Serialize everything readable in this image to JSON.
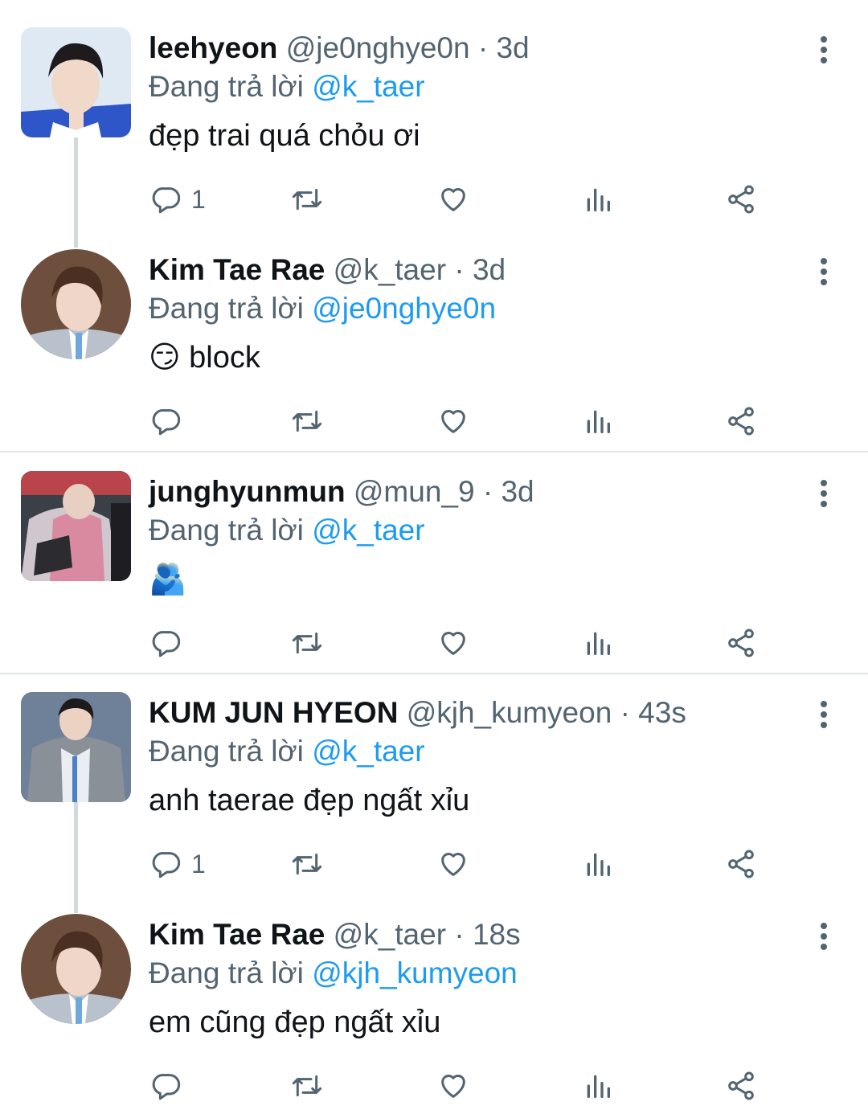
{
  "reply_prefix": "Đang trả lời",
  "colors": {
    "mention": "#1d9bf0",
    "secondary_text": "#536471",
    "thread_line": "#cfd9de",
    "divider": "#e1e6ea"
  },
  "tweets": [
    {
      "name": "leehyeon",
      "handle": "@je0nghye0n",
      "time": "3d",
      "reply_to": "@k_taer",
      "text": "đẹp trai quá chỏu ơi",
      "reply_count": "1",
      "avatar_icon": "profile-photo-square"
    },
    {
      "name": "Kim Tae Rae",
      "handle": "@k_taer",
      "time": "3d",
      "reply_to": "@je0nghye0n",
      "text": "😏 block",
      "reply_count": "",
      "avatar_icon": "profile-photo-circle"
    },
    {
      "name": "junghyunmun",
      "handle": "@mun_9",
      "time": "3d",
      "reply_to": "@k_taer",
      "text": "🫂",
      "reply_count": "",
      "avatar_icon": "profile-photo-square"
    },
    {
      "name": "KUM JUN HYEON",
      "handle": "@kjh_kumyeon",
      "time": "43s",
      "reply_to": "@k_taer",
      "text": "anh taerae đẹp ngất xỉu",
      "reply_count": "1",
      "avatar_icon": "profile-photo-square"
    },
    {
      "name": "Kim Tae Rae",
      "handle": "@k_taer",
      "time": "18s",
      "reply_to": "@kjh_kumyeon",
      "text": "em cũng đẹp ngất xỉu",
      "reply_count": "",
      "avatar_icon": "profile-photo-circle"
    }
  ],
  "separator": "·"
}
